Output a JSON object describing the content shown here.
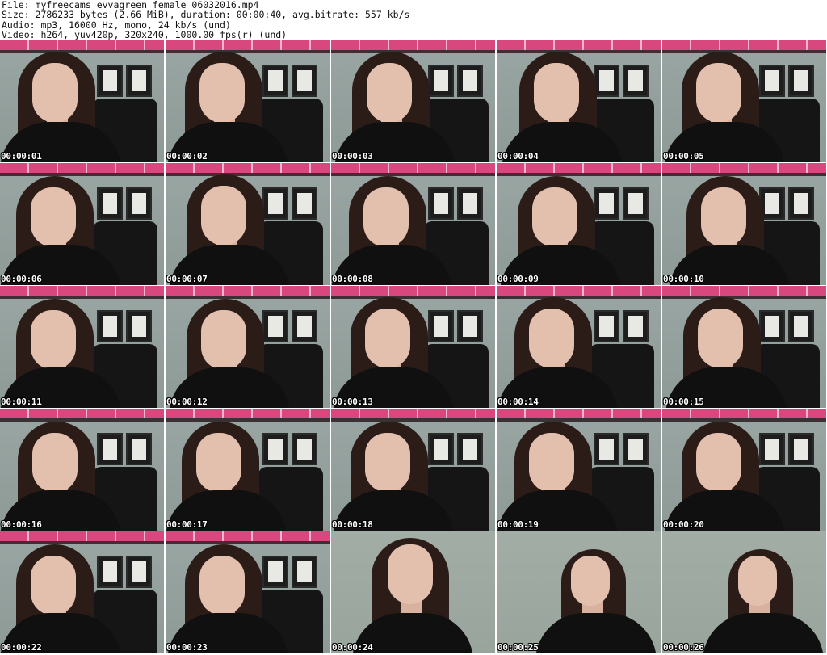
{
  "header": {
    "line1": "File: myfreecams_evvagreen_female_06032016.mp4",
    "line2": "Size: 2786233 bytes (2.66 MiB), duration: 00:00:40, avg.bitrate: 557 kb/s",
    "line3": "Audio: mp3, 16000 Hz, mono, 24 kb/s (und)",
    "line4": "Video: h264, yuv420p, 320x240, 1000.00 fps(r) (und)"
  },
  "thumbnails": [
    {
      "timestamp": "00:00:01"
    },
    {
      "timestamp": "00:00:02"
    },
    {
      "timestamp": "00:00:03"
    },
    {
      "timestamp": "00:00:04"
    },
    {
      "timestamp": "00:00:05"
    },
    {
      "timestamp": "00:00:06"
    },
    {
      "timestamp": "00:00:07"
    },
    {
      "timestamp": "00:00:08"
    },
    {
      "timestamp": "00:00:09"
    },
    {
      "timestamp": "00:00:10"
    },
    {
      "timestamp": "00:00:11"
    },
    {
      "timestamp": "00:00:12"
    },
    {
      "timestamp": "00:00:13"
    },
    {
      "timestamp": "00:00:14"
    },
    {
      "timestamp": "00:00:15"
    },
    {
      "timestamp": "00:00:16"
    },
    {
      "timestamp": "00:00:17"
    },
    {
      "timestamp": "00:00:18"
    },
    {
      "timestamp": "00:00:19"
    },
    {
      "timestamp": "00:00:20"
    },
    {
      "timestamp": "00:00:22"
    },
    {
      "timestamp": "00:00:23"
    },
    {
      "timestamp": "00:00:24"
    },
    {
      "timestamp": "00:00:25"
    },
    {
      "timestamp": "00:00:26"
    }
  ]
}
